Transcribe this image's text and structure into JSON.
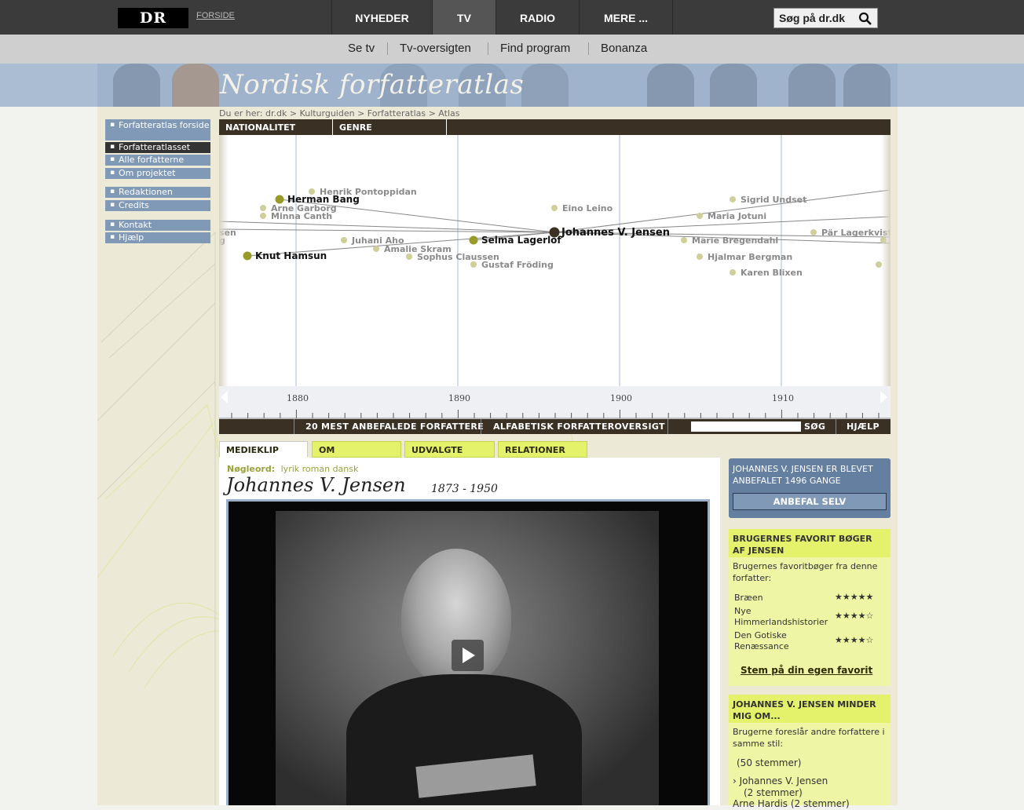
{
  "topnav": {
    "logo": "DR",
    "forside": "FORSIDE",
    "tabs": [
      "NYHEDER",
      "TV",
      "RADIO",
      "MERE ..."
    ],
    "search_placeholder": "Søg på dr.dk"
  },
  "subnav": [
    "Se tv",
    "Tv-oversigten",
    "Find program",
    "Bonanza"
  ],
  "banner": {
    "title": "Nordisk forfatteratlas"
  },
  "leftnav": {
    "group1": [
      "Forfatteratlas forside",
      "Forfatteratlasset",
      "Alle forfatterne",
      "Om projektet"
    ],
    "group2": [
      "Redaktionen",
      "Credits"
    ],
    "group3": [
      "Kontakt",
      "Hjælp"
    ]
  },
  "breadcrumb": "Du er her: dr.dk > Kulturguiden > Forfatteratlas > Atlas",
  "atlas": {
    "tabs": [
      "NATIONALITET",
      "GENRE"
    ],
    "years": [
      "1880",
      "1890",
      "1900",
      "1910"
    ],
    "authors": [
      {
        "name": "Henrik Pontoppidan"
      },
      {
        "name": "Herman Bang"
      },
      {
        "name": "Arne Garborg"
      },
      {
        "name": "Minna Canth"
      },
      {
        "name": "sen"
      },
      {
        "name": "g"
      },
      {
        "name": "Juhani Aho"
      },
      {
        "name": "Amalie Skram"
      },
      {
        "name": "Knut Hamsun"
      },
      {
        "name": "Sophus Claussen"
      },
      {
        "name": "Selma Lagerlöf"
      },
      {
        "name": "Gustaf Fröding"
      },
      {
        "name": "Eino Leino"
      },
      {
        "name": "Johannes V. Jensen"
      },
      {
        "name": "Sigrid Undset"
      },
      {
        "name": "Maria Jotuni"
      },
      {
        "name": "Marie Bregendahl"
      },
      {
        "name": "Hjalmar Bergman"
      },
      {
        "name": "Karen Blixen"
      },
      {
        "name": "Pär Lagerkvist"
      }
    ],
    "footer": {
      "top20": "20 MEST ANBEFALEDE FORFATTERE",
      "alpha": "ALFABETISK FORFATTEROVERSIGT",
      "search": "SØG",
      "help": "HJÆLP"
    }
  },
  "content": {
    "tabs": [
      "MEDIEKLIP",
      "OM FORFATTEREN",
      "UDVALGTE BØGER",
      "RELATIONER"
    ],
    "keywords_label": "Nøgleord:",
    "keywords": "lyrik roman dansk",
    "author_name": "Johannes V. Jensen",
    "author_years": "1873 - 1950"
  },
  "right": {
    "recommend_text": "JOHANNES V. JENSEN ER BLEVET ANBEFALET 1496 GANGE",
    "recommend_button": "ANBEFAL SELV",
    "fav_heading": "BRUGERNES FAVORIT BØGER AF JENSEN",
    "fav_intro": "Brugernes favoritbøger fra denne forfatter:",
    "fav_books": [
      {
        "title": "Bræen",
        "stars": 5
      },
      {
        "title": "Nye Himmerlandshistorier",
        "stars": 4
      },
      {
        "title": "Den Gotiske Renæssance",
        "stars": 4
      }
    ],
    "own_fav": "Stem på din egen favorit",
    "remind_heading": "JOHANNES V. JENSEN MINDER MIG OM...",
    "remind_intro": "Brugerne foreslår andre forfattere i samme stil:",
    "votes_total": "(50 stemmer)",
    "remind_items": [
      {
        "name": "Johannes V. Jensen",
        "votes": "(2 stemmer)"
      },
      {
        "name": "Arne Hardis",
        "votes": "(2 stemmer)"
      }
    ]
  }
}
